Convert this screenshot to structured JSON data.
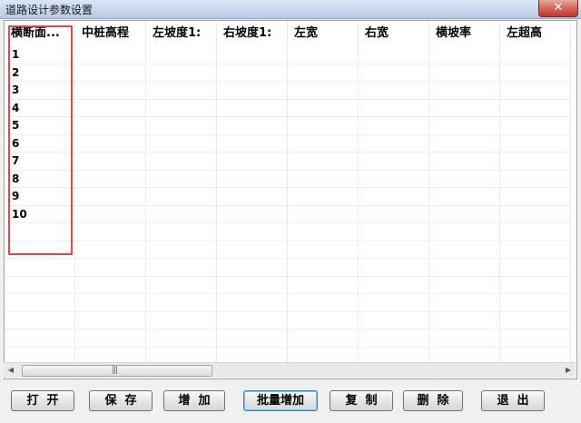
{
  "window": {
    "title": "道路设计参数设置",
    "close_label": "✕"
  },
  "grid": {
    "columns": [
      "横断面...",
      "中桩高程",
      "左坡度1:",
      "右坡度1:",
      "左宽",
      "右宽",
      "横坡率",
      "左超高"
    ],
    "row_labels": [
      "1",
      "2",
      "3",
      "4",
      "5",
      "6",
      "7",
      "8",
      "9",
      "10"
    ],
    "scroll_grip": "|||"
  },
  "scrollbar": {
    "left_arrow_icon": "◀",
    "right_arrow_icon": "▶"
  },
  "buttons": {
    "open": "打  开",
    "save": "保  存",
    "add": "增  加",
    "batch_add": "批量增加",
    "copy": "复  制",
    "delete": "删  除",
    "exit": "退  出"
  }
}
